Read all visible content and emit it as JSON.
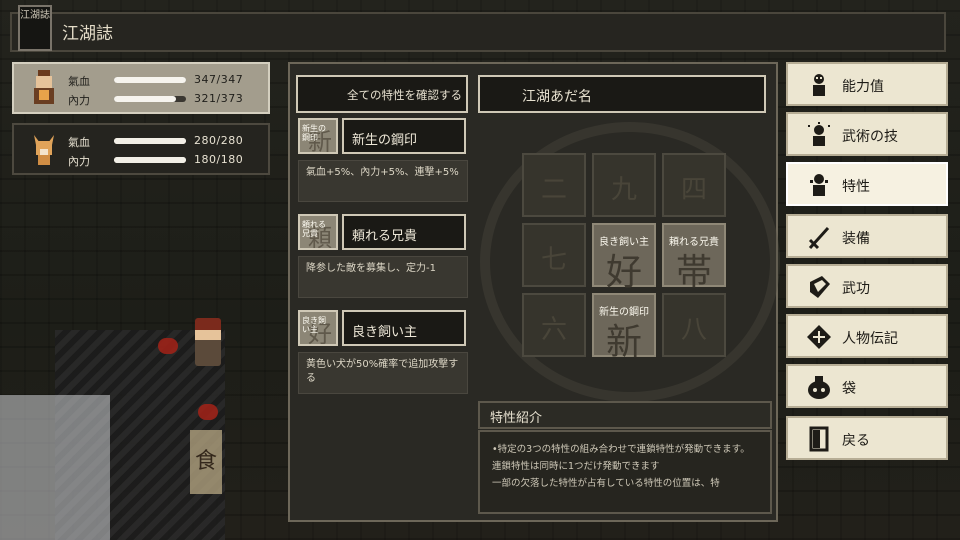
{
  "header": {
    "title": "江湖誌",
    "book_icon_text": "江湖誌"
  },
  "characters": [
    {
      "stats": [
        {
          "label": "氣血",
          "value": "347/347",
          "fill": 1.0
        },
        {
          "label": "內力",
          "value": "321/373",
          "fill": 0.86
        }
      ]
    },
    {
      "stats": [
        {
          "label": "氣血",
          "value": "280/280",
          "fill": 1.0
        },
        {
          "label": "內力",
          "value": "180/180",
          "fill": 1.0
        }
      ]
    }
  ],
  "traits_panel": {
    "all_traits_button": "全ての特性を確認する",
    "nickname_label": "江湖あだ名",
    "traits": [
      {
        "icon_big": "新",
        "icon_small": "新生の鋼印",
        "name": "新生の鋼印",
        "description": "氣血+5%、內力+5%、連撃+5%"
      },
      {
        "icon_big": "頼",
        "icon_small": "頼れる兄貴",
        "name": "頼れる兄貴",
        "description": "降参した敵を募集し、定力-1"
      },
      {
        "icon_big": "好",
        "icon_small": "良き飼い主",
        "name": "良き飼い主",
        "description": "黄色い犬が50%確率で追加攻撃する"
      }
    ],
    "grid": [
      {
        "glyph": "二",
        "filled": false,
        "tag": ""
      },
      {
        "glyph": "九",
        "filled": false,
        "tag": ""
      },
      {
        "glyph": "四",
        "filled": false,
        "tag": ""
      },
      {
        "glyph": "七",
        "filled": false,
        "tag": ""
      },
      {
        "glyph": "好",
        "filled": true,
        "tag": "良き飼い主"
      },
      {
        "glyph": "帯",
        "filled": true,
        "tag": "頼れる兄貴"
      },
      {
        "glyph": "六",
        "filled": false,
        "tag": ""
      },
      {
        "glyph": "新",
        "filled": true,
        "tag": "新生の鋼印"
      },
      {
        "glyph": "八",
        "filled": false,
        "tag": ""
      }
    ],
    "info": {
      "title": "特性紹介",
      "lines": [
        "•特定の3つの特性の組み合わせで連鎖特性が発動できます。連鎖特性は同時に1つだけ発動できます",
        "一部の欠落した特性が占有している特性の位置は、特"
      ]
    }
  },
  "menu": [
    {
      "label": "能力值",
      "icon": "person-icon"
    },
    {
      "label": "武術の技",
      "icon": "martial-person-icon"
    },
    {
      "label": "特性",
      "icon": "trait-person-icon",
      "selected": true
    },
    {
      "label": "装備",
      "icon": "sword-icon"
    },
    {
      "label": "武功",
      "icon": "book-icon"
    },
    {
      "label": "人物伝記",
      "icon": "scroll-icon"
    },
    {
      "label": "袋",
      "icon": "bag-icon"
    },
    {
      "label": "戻る",
      "icon": "door-icon"
    }
  ],
  "colors": {
    "panel": "#2a2924",
    "menu_bg": "#ece6d1",
    "selected_char_bg": "#a39d8d"
  }
}
